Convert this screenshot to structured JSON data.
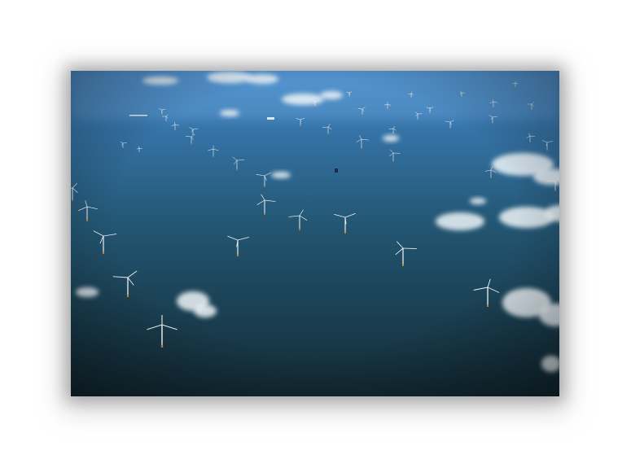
{
  "photo": {
    "subject": "offshore-wind-farm-aerial",
    "colors": {
      "sea_top": "#3f83c2",
      "sea_mid": "#1f4f6e",
      "sea_bottom": "#15303c",
      "cloud": "#eef4f8",
      "turbine": "#f2f4f5",
      "turbine_base": "#d9872b"
    }
  }
}
